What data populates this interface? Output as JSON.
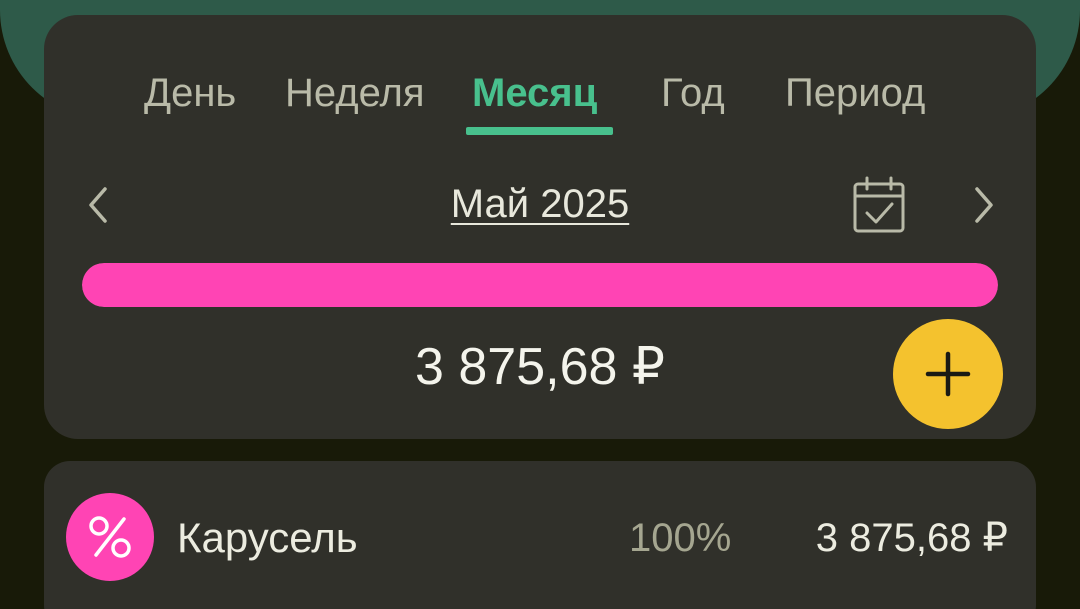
{
  "tabs": [
    {
      "label": "День"
    },
    {
      "label": "Неделя"
    },
    {
      "label": "Месяц"
    },
    {
      "label": "Год"
    },
    {
      "label": "Период"
    }
  ],
  "active_tab": "Месяц",
  "period": {
    "label": "Май 2025",
    "prev_icon": "chevron-left-icon",
    "next_icon": "chevron-right-icon",
    "calendar_icon": "calendar-check-icon"
  },
  "progress": {
    "fraction": 1.0,
    "color": "#ff44b4"
  },
  "summary": {
    "total": "3 875,68 ₽"
  },
  "fab": {
    "icon": "plus-icon",
    "color": "#f4c22e"
  },
  "categories": [
    {
      "name": "Карусель",
      "percent": "100%",
      "amount": "3 875,68 ₽",
      "icon": "percent-icon",
      "color": "#ff44b4"
    }
  ],
  "colors": {
    "accent": "#48c08d",
    "card": "#30302a",
    "header": "#2e5a49",
    "background": "#181a08"
  }
}
